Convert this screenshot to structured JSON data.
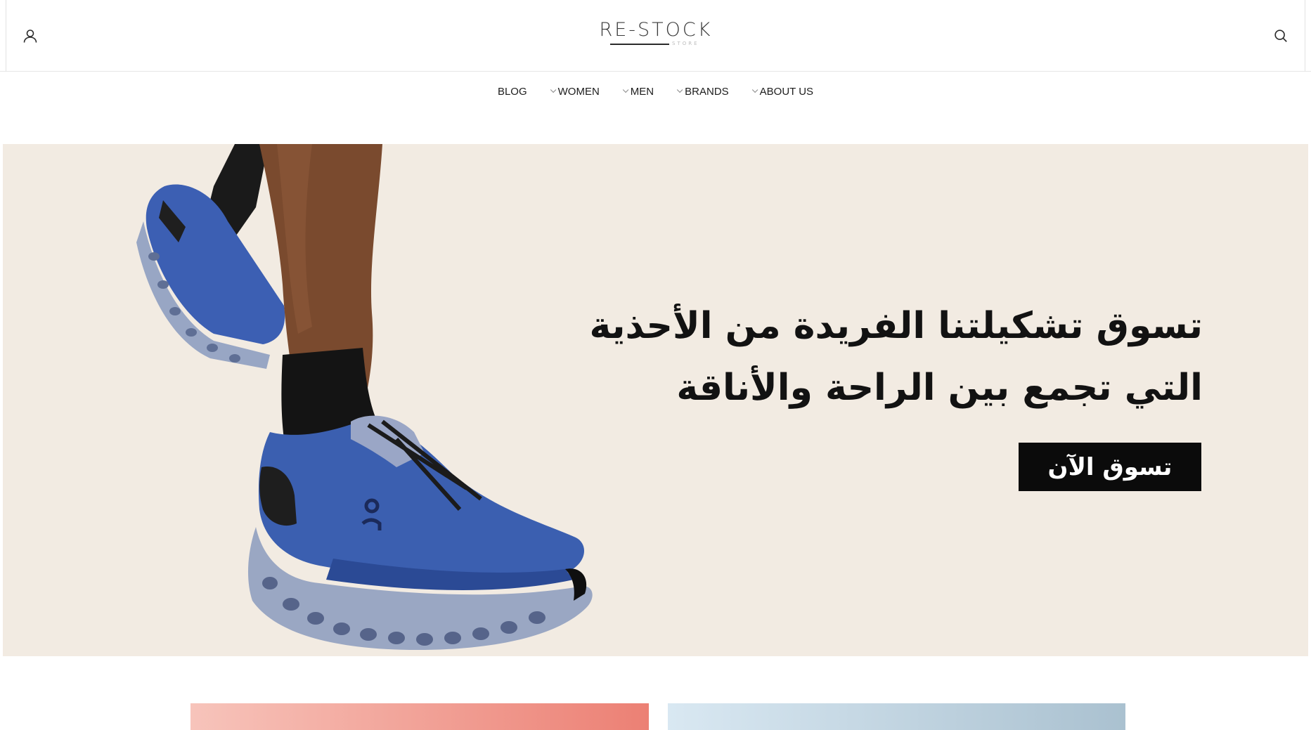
{
  "header": {
    "logo_text": "RE-STOCK",
    "logo_subtext": "STORE",
    "account_icon": "user-icon",
    "search_icon": "search-icon"
  },
  "nav": {
    "items": [
      {
        "label": "BLOG",
        "has_dropdown": false
      },
      {
        "label": "WOMEN",
        "has_dropdown": true
      },
      {
        "label": "MEN",
        "has_dropdown": true
      },
      {
        "label": "BRANDS",
        "has_dropdown": true
      },
      {
        "label": "ABOUT US",
        "has_dropdown": true
      }
    ]
  },
  "hero": {
    "headline_line1": "تسوق تشكيلتنا الفريدة من الأحذية",
    "headline_line2": "التي تجمع بين الراحة والأناقة",
    "cta_label": "تسوق الآن",
    "background_color": "#f2ebe2",
    "shoe_color": "#3b5fb0"
  },
  "category_strips": {
    "left_colors": [
      "#f7c4bb",
      "#ec8074"
    ],
    "right_colors": [
      "#d9e8f2",
      "#aac1d0"
    ]
  }
}
